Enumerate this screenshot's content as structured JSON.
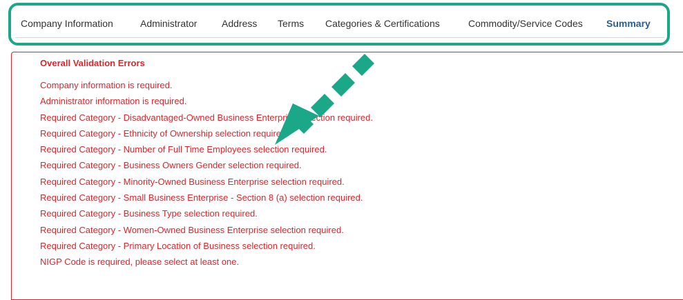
{
  "tabs": [
    {
      "label": "Company Information",
      "active": false
    },
    {
      "label": "Administrator",
      "active": false
    },
    {
      "label": "Address",
      "active": false
    },
    {
      "label": "Terms",
      "active": false
    },
    {
      "label": "Categories & Certifications",
      "active": false
    },
    {
      "label": "Commodity/Service Codes",
      "active": false
    },
    {
      "label": "Summary",
      "active": true
    }
  ],
  "validation": {
    "title": "Overall Validation Errors",
    "errors": [
      "Company information is required.",
      "Administrator information is required.",
      "Required Category - Disadvantaged-Owned Business Enterprise selection required.",
      "Required Category - Ethnicity of Ownership selection required.",
      "Required Category - Number of Full Time Employees selection required.",
      "Required Category - Business Owners Gender selection required.",
      "Required Category - Minority-Owned Business Enterprise selection required.",
      "Required Category - Small Business Enterprise - Section 8 (a) selection required.",
      "Required Category - Business Type selection required.",
      "Required Category - Women-Owned Business Enterprise selection required.",
      "Required Category - Primary Location of Business selection required.",
      "NIGP Code is required, please select at least one."
    ]
  },
  "colors": {
    "error_red": "#e0242a",
    "active_tab_blue": "#2a5e8c",
    "annotation_teal": "#1aa889"
  },
  "annotations": {
    "highlight_icon": "rounded-highlight-box",
    "arrow_icon": "dashed-arrow-down-left"
  }
}
